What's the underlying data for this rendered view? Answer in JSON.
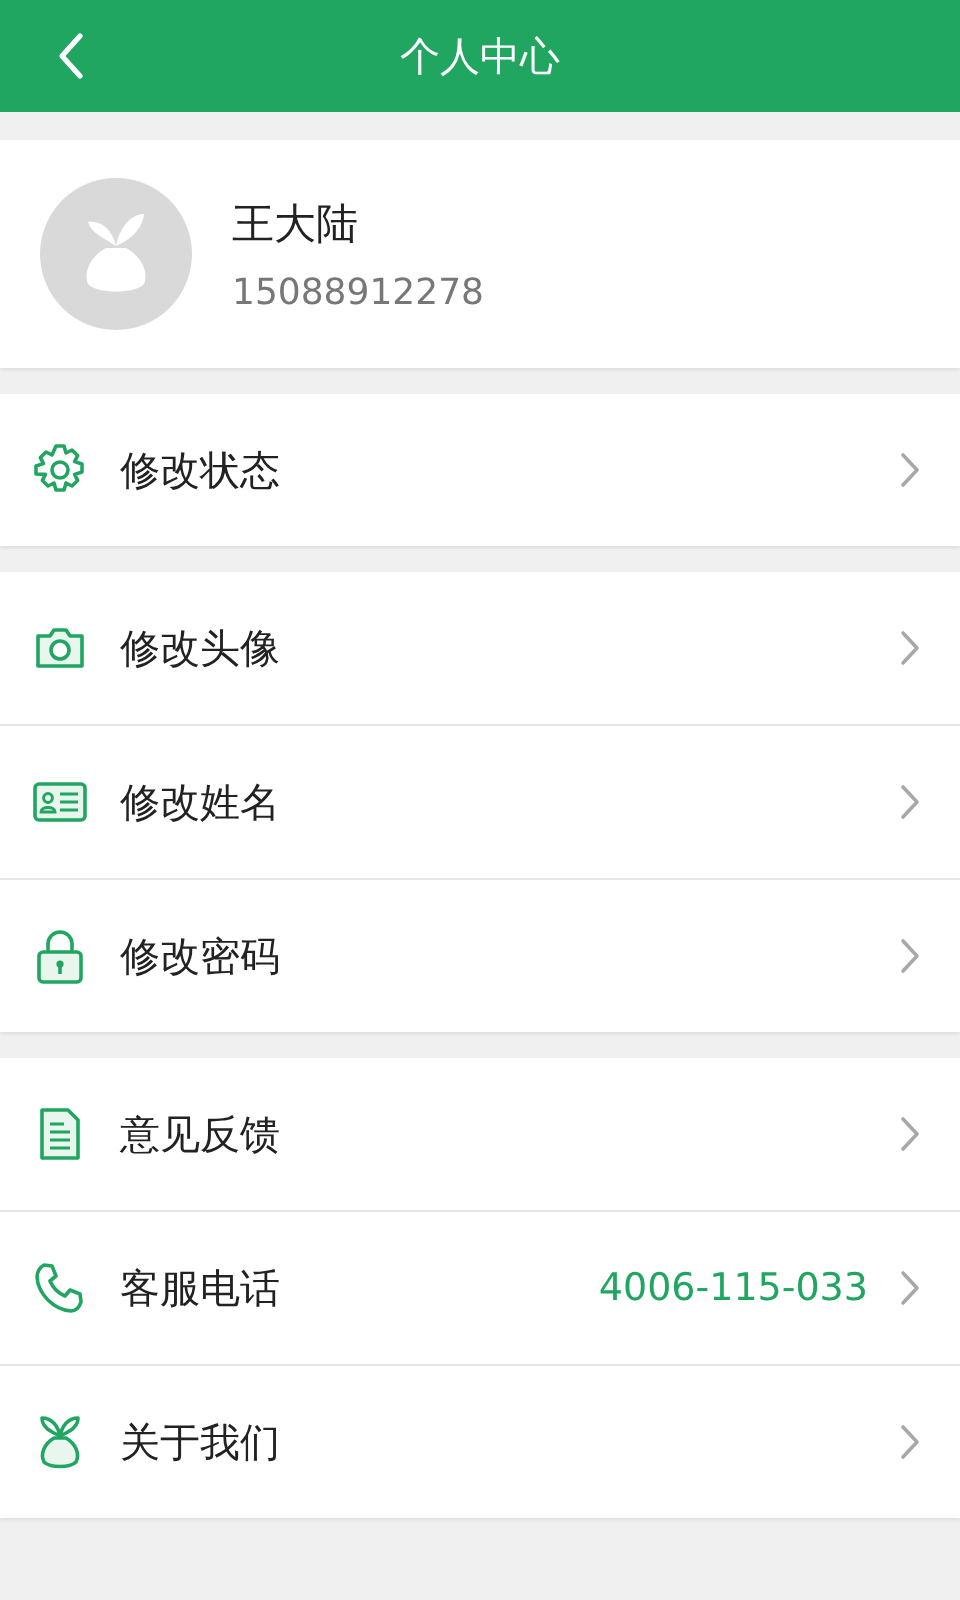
{
  "header": {
    "title": "个人中心"
  },
  "profile": {
    "name": "王大陆",
    "phone": "15088912278"
  },
  "groups": [
    {
      "items": [
        {
          "label": "修改状态"
        }
      ]
    },
    {
      "items": [
        {
          "label": "修改头像"
        },
        {
          "label": "修改姓名"
        },
        {
          "label": "修改密码"
        }
      ]
    },
    {
      "items": [
        {
          "label": "意见反馈"
        },
        {
          "label": "客服电话",
          "value": "4006-115-033"
        },
        {
          "label": "关于我们"
        }
      ]
    }
  ]
}
